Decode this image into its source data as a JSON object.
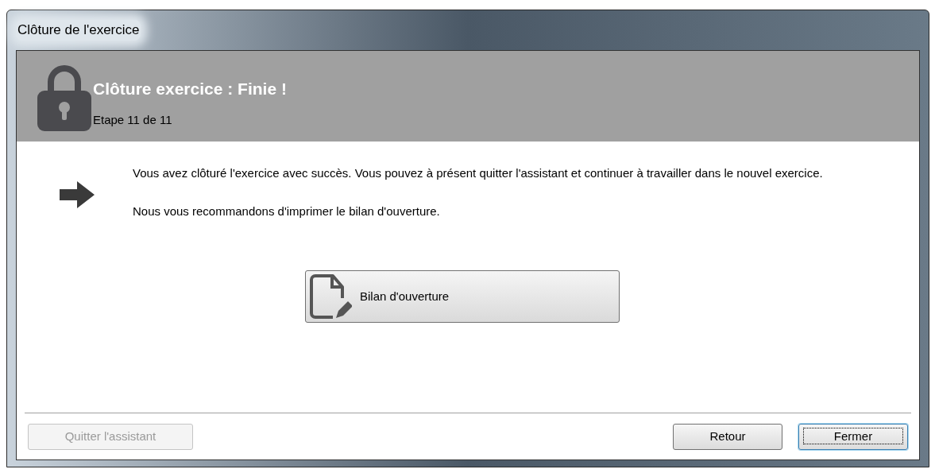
{
  "window": {
    "title": "Clôture de l'exercice"
  },
  "header": {
    "title": "Clôture exercice : Finie !",
    "step": "Etape 11 de 11"
  },
  "messages": [
    "Vous avez clôturé l'exercice avec succès. Vous pouvez à présent quitter l'assistant et continuer à travailler dans le nouvel exercice.",
    "Nous vous recommandons d'imprimer le bilan d'ouverture."
  ],
  "action_button": {
    "label": "Bilan d'ouverture"
  },
  "footer_buttons": [
    {
      "label": "Quitter l'assistant",
      "disabled": true,
      "focused": false
    },
    {
      "label": "Retour",
      "disabled": false,
      "focused": false
    },
    {
      "label": "Fermer",
      "disabled": false,
      "focused": true
    }
  ]
}
